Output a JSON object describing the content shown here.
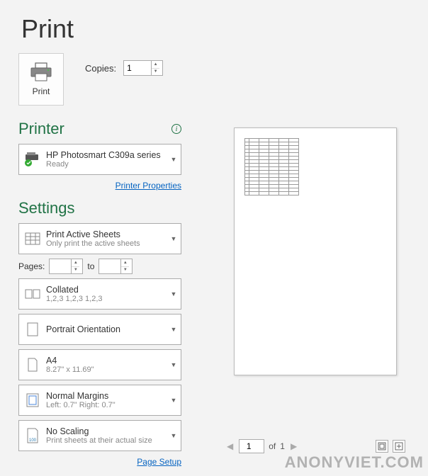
{
  "page": {
    "title": "Print"
  },
  "printBtn": {
    "label": "Print"
  },
  "copies": {
    "label": "Copies:",
    "value": "1"
  },
  "printerSection": {
    "header": "Printer"
  },
  "printer": {
    "name": "HP Photosmart C309a series",
    "status": "Ready",
    "propertiesLink": "Printer Properties"
  },
  "settingsSection": {
    "header": "Settings"
  },
  "printArea": {
    "title": "Print Active Sheets",
    "subtitle": "Only print the active sheets"
  },
  "pages": {
    "label": "Pages:",
    "from": "",
    "toLabel": "to",
    "to": ""
  },
  "collate": {
    "title": "Collated",
    "subtitle": "1,2,3   1,2,3   1,2,3"
  },
  "orientation": {
    "title": "Portrait Orientation"
  },
  "paper": {
    "title": "A4",
    "subtitle": "8.27\" x 11.69\""
  },
  "margins": {
    "title": "Normal Margins",
    "subtitle": "Left:  0.7\"    Right:  0.7\""
  },
  "scaling": {
    "title": "No Scaling",
    "subtitle": "Print sheets at their actual size",
    "iconNumber": "100"
  },
  "pageSetup": {
    "link": "Page Setup"
  },
  "previewNav": {
    "current": "1",
    "ofLabel": "of",
    "total": "1"
  },
  "watermark": "ANONYVIET.COM"
}
